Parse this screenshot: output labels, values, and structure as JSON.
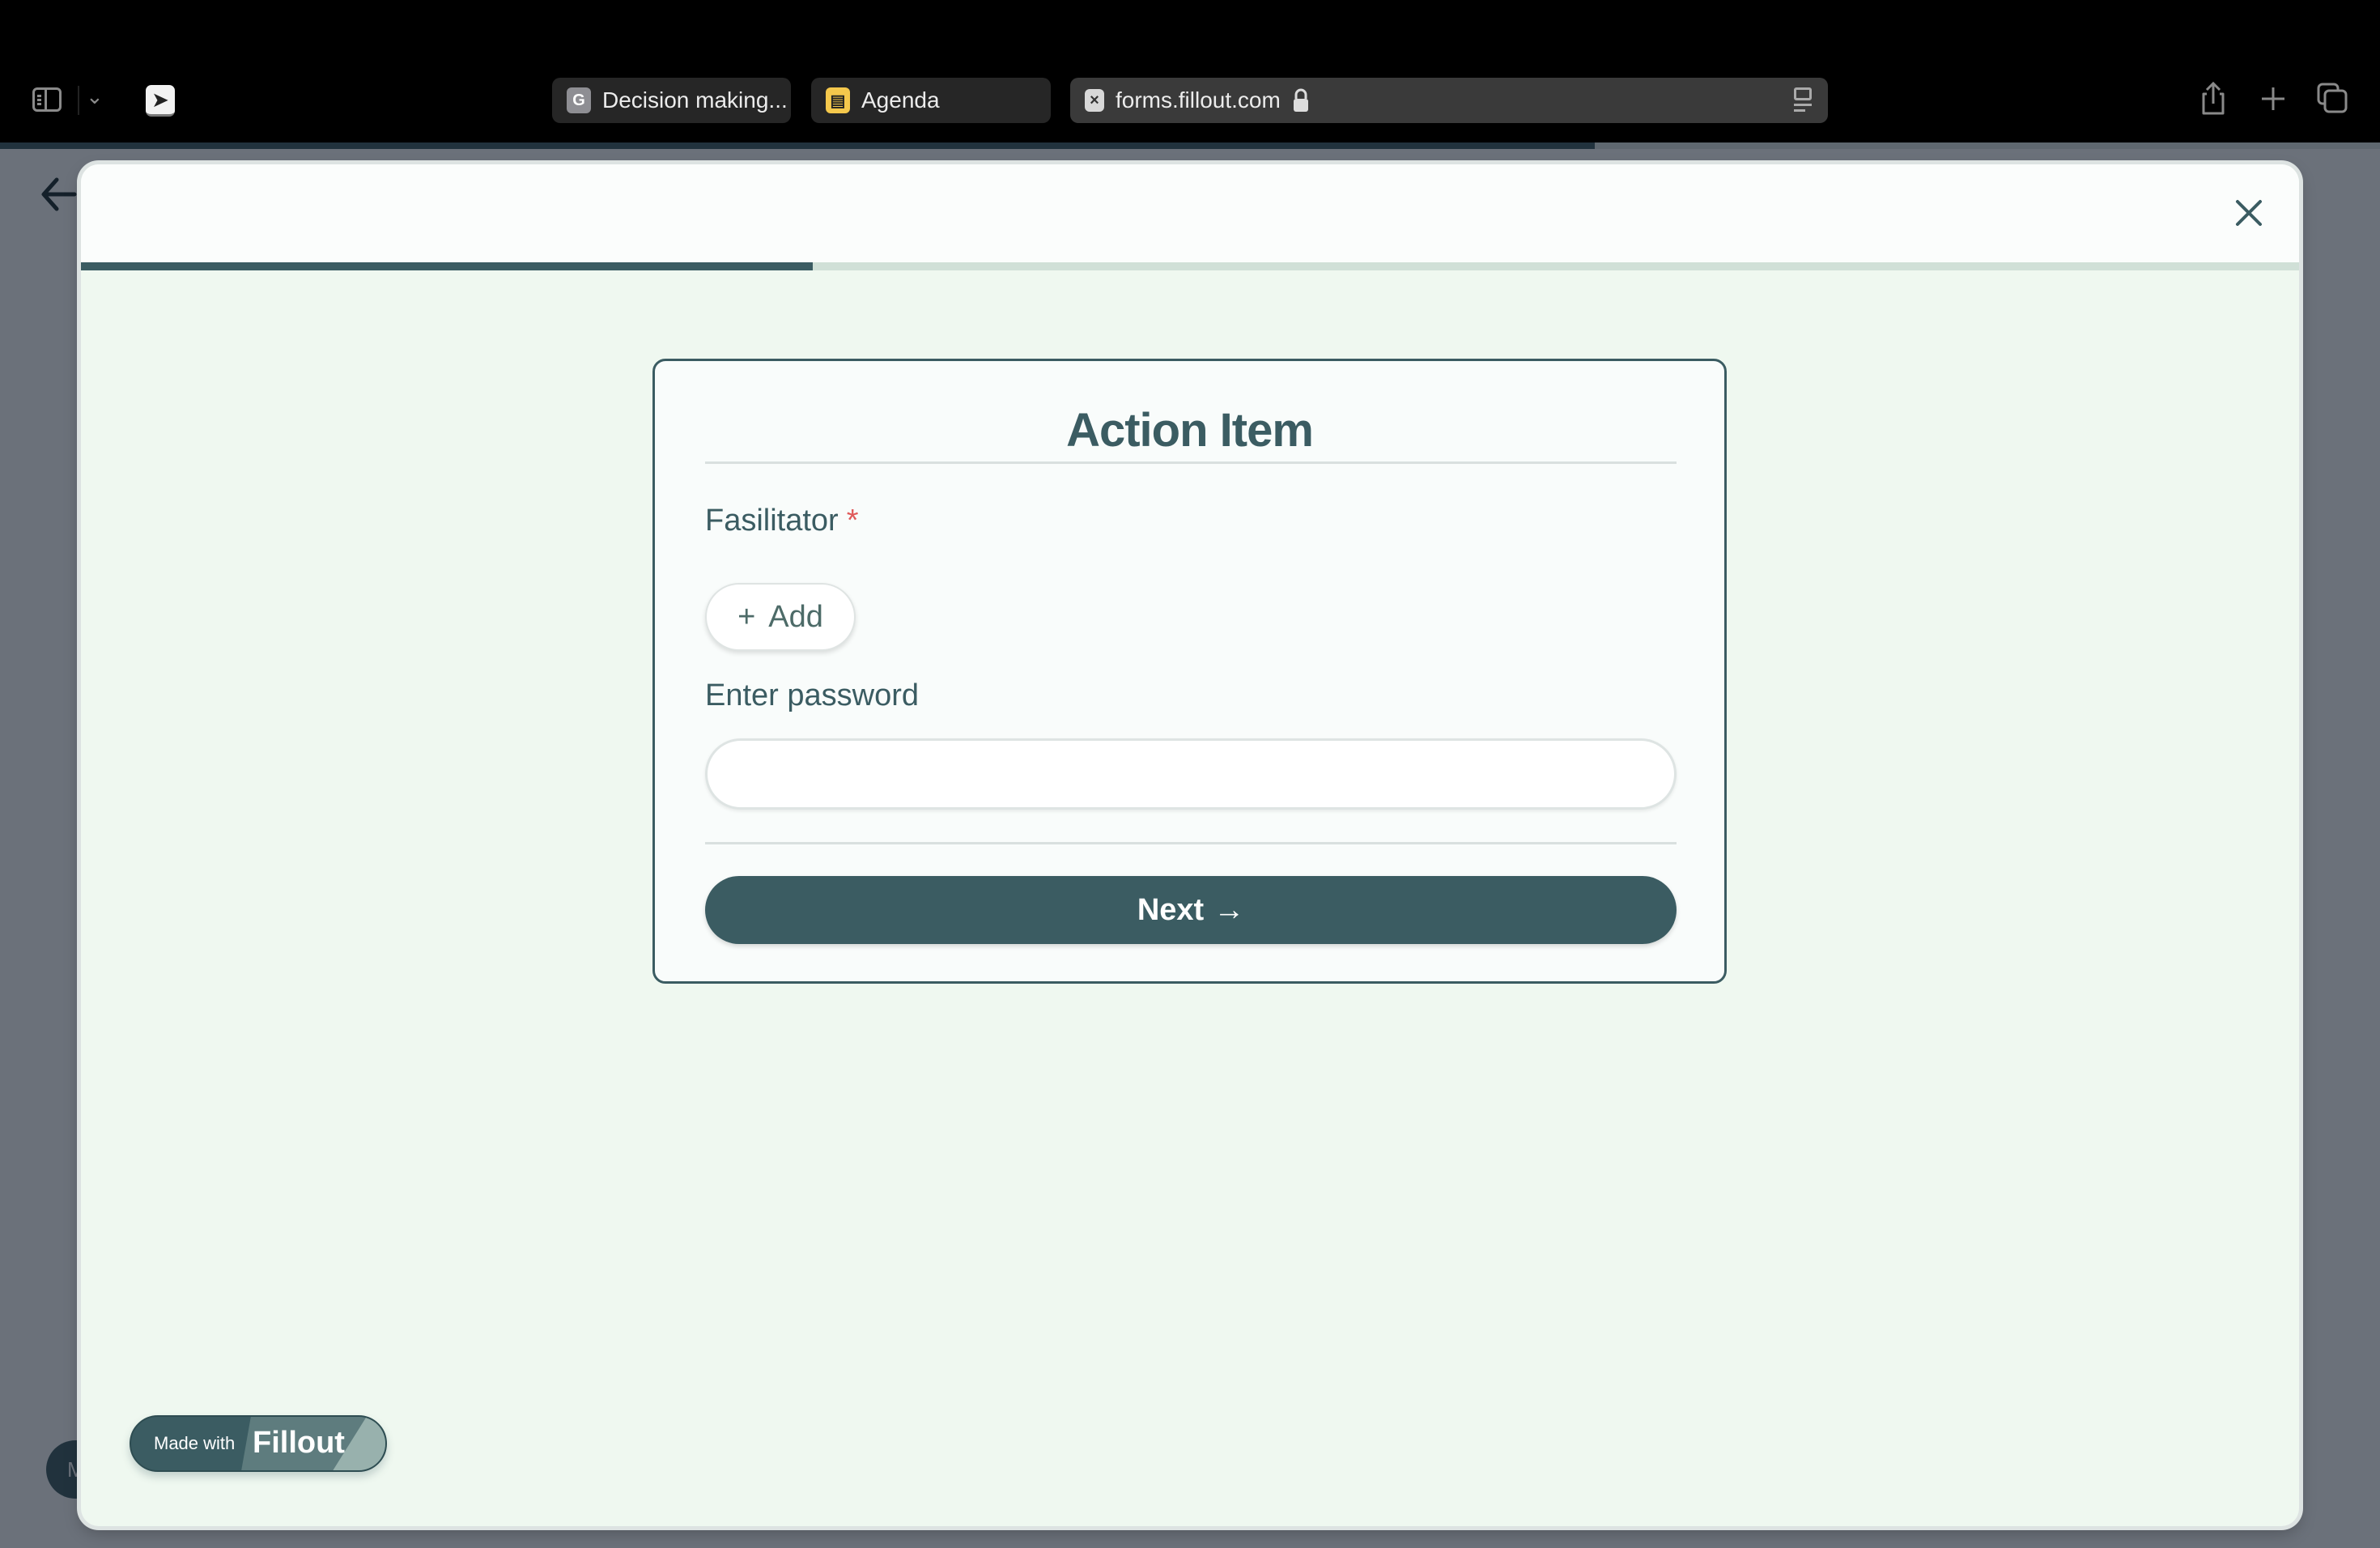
{
  "browser": {
    "tabs": [
      {
        "label": "Decision making...",
        "favicon": "G",
        "favicon_color": "#8e8e93",
        "active": false
      },
      {
        "label": "Agenda",
        "favicon": "agenda-doc-icon",
        "favicon_color": "#f5c84c",
        "active": false
      },
      {
        "label": "forms.fillout.com",
        "favicon": "fillout-x-icon",
        "favicon_color": "#d8d8d8",
        "active": true,
        "secure": true
      }
    ],
    "toolbar_icons": [
      "sidebar-icon",
      "chevron-down-icon",
      "paper-plane-extension-icon",
      "reader-icon",
      "share-icon",
      "new-tab-icon",
      "tab-overview-icon"
    ],
    "page_load_progress": 0.67
  },
  "page": {
    "back_icon": "arrow-left-icon",
    "left_bubble_text": "M"
  },
  "modal": {
    "close_icon": "close-icon",
    "form_progress": 0.33,
    "card": {
      "title": "Action Item",
      "fields": [
        {
          "label": "Fasilitator",
          "required": true,
          "required_mark": "*",
          "button_label": "Add",
          "button_icon": "plus-icon"
        },
        {
          "label": "Enter password",
          "type": "password",
          "value": "",
          "placeholder": ""
        }
      ],
      "next_label": "Next",
      "next_icon": "→"
    },
    "badge": {
      "prefix": "Made with",
      "brand": "Fillout"
    }
  },
  "colors": {
    "primary": "#3b5c62",
    "background": "#eff8f0",
    "required": "#e05a5a"
  }
}
